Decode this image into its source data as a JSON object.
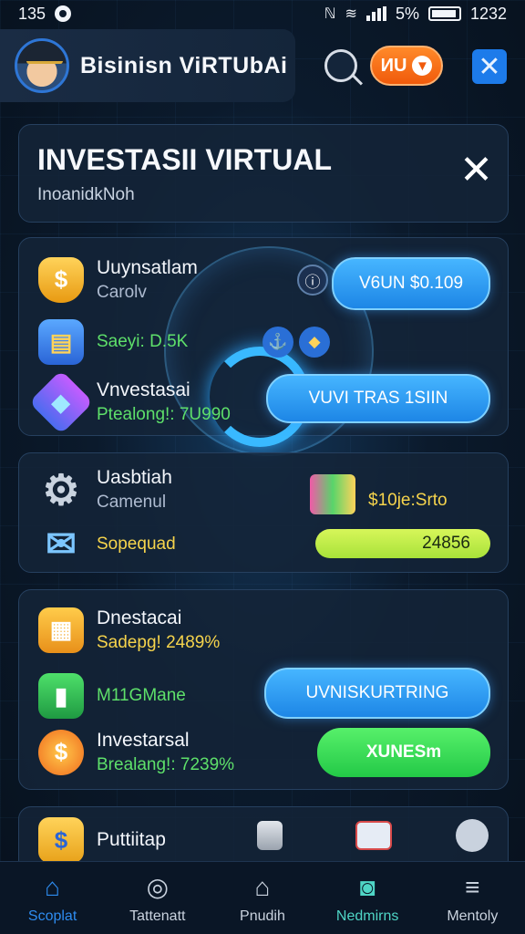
{
  "status_bar": {
    "left_time": "135",
    "right_battery": "5%",
    "right_time": "1232"
  },
  "header": {
    "title": "Bisinisn ViRTUbAi",
    "orange_button": "ИU"
  },
  "title_card": {
    "title": "INVESTASII VIRTUAL",
    "subtitle": "InoanidkNoh"
  },
  "card1": {
    "rows": [
      {
        "icon": "shield-dollar-icon",
        "title": "Uuynsatlam",
        "sub": "Carolv"
      },
      {
        "icon": "wallet-icon",
        "sub": "Saeyi: D.5K"
      },
      {
        "icon": "diamond-icon",
        "title": "Vnvestasai",
        "sub": "Ptealong!: 7U990"
      }
    ],
    "pill_top": "V6UN $0.109",
    "pill_bottom": "VUVI TRAS 1SIIN",
    "small_circle_left": "⚓",
    "small_circle_right": "◆",
    "small_circle_top": "ⓘ"
  },
  "card2": {
    "rows": [
      {
        "icon": "gear-icon",
        "title": "Uasbtiah",
        "sub": "Camenul"
      },
      {
        "icon": "mail-icon",
        "title": "Sopequad"
      }
    ],
    "value_text": "$10je:Srto",
    "lime_pill": "24856"
  },
  "card3": {
    "rows": [
      {
        "icon": "coins-box-icon",
        "title": "Dnestacai",
        "sub": "Sadepg! 2489%"
      },
      {
        "icon": "growth-chart-icon",
        "title": "M11GMane"
      },
      {
        "icon": "dollar-badge-icon",
        "title": "Investarsal",
        "sub": "Brealang!: 7239%"
      }
    ],
    "blue_pill": "UVNISKURTRING",
    "green_pill": "XUNESm"
  },
  "card4": {
    "title": "Puttiitap"
  },
  "bottom_nav": [
    {
      "label": "Scoplat",
      "icon": "home-icon"
    },
    {
      "label": "Tattenatt",
      "icon": "radar-icon"
    },
    {
      "label": "Pnudih",
      "icon": "store-icon"
    },
    {
      "label": "Nedmirns",
      "icon": "camera-icon"
    },
    {
      "label": "Mentoly",
      "icon": "menu-icon"
    }
  ],
  "colors": {
    "accent_blue": "#2e8cf0",
    "accent_orange": "#f05a0b",
    "accent_green": "#5ee06a",
    "accent_yellow": "#f6d44c"
  }
}
